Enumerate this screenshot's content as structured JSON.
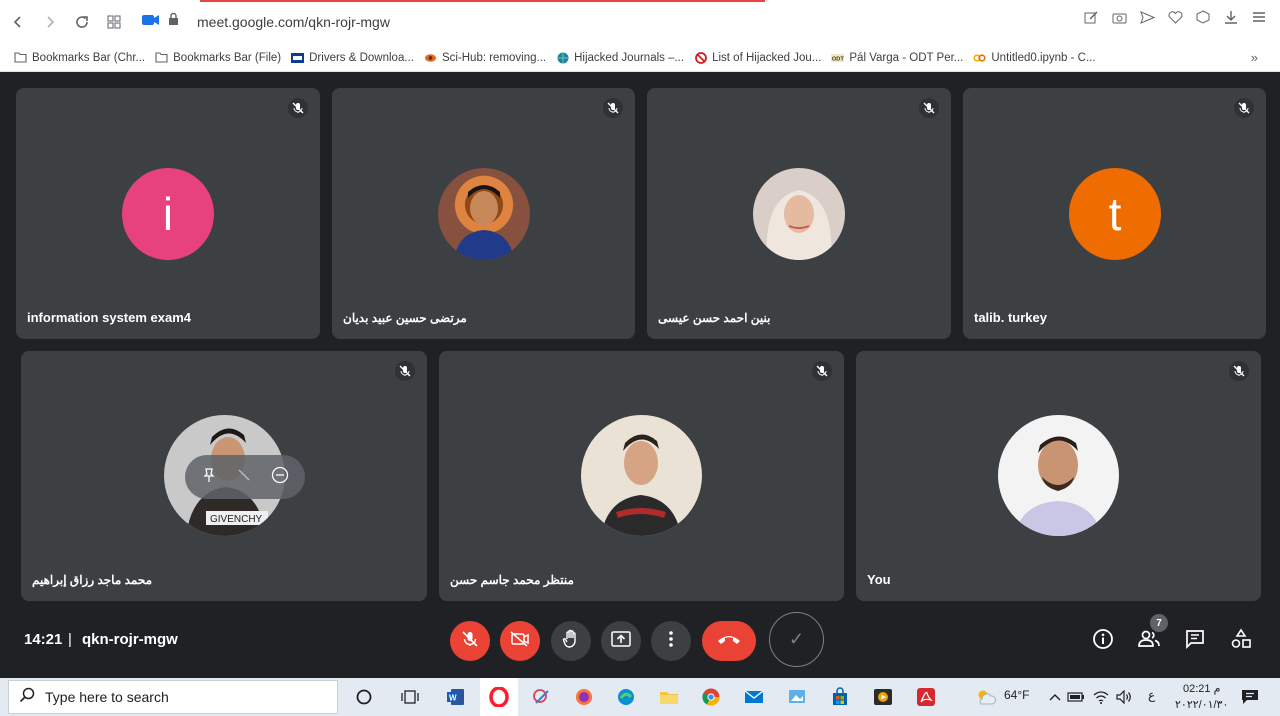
{
  "browser": {
    "url": "meet.google.com/qkn-rojr-mgw"
  },
  "bookmarks": [
    {
      "label": "Bookmarks Bar (Chr...",
      "icon": "folder-icon"
    },
    {
      "label": "Bookmarks Bar (File)",
      "icon": "folder-icon"
    },
    {
      "label": "Drivers & Downloa...",
      "icon": "hp-icon"
    },
    {
      "label": "Sci-Hub: removing...",
      "icon": "scihub-icon"
    },
    {
      "label": "Hijacked Journals –...",
      "icon": "globe-icon"
    },
    {
      "label": "List of Hijacked Jou...",
      "icon": "blocked-icon"
    },
    {
      "label": "Pál Varga - ODT Per...",
      "icon": "odt-icon"
    },
    {
      "label": "Untitled0.ipynb - C...",
      "icon": "colab-icon"
    }
  ],
  "participants_row1": [
    {
      "name": "information system exam4",
      "avatar_type": "letter",
      "letter": "i",
      "color": "#e8427c",
      "rtl": false
    },
    {
      "name": "مرتضى حسين عبيد بديان",
      "avatar_type": "photo",
      "rtl": true
    },
    {
      "name": "بنين احمد حسن عيسى",
      "avatar_type": "photo",
      "rtl": true
    },
    {
      "name": "talib. turkey",
      "avatar_type": "letter",
      "letter": "t",
      "color": "#ef6c00",
      "rtl": false
    }
  ],
  "participants_row2": [
    {
      "name": "محمد ماجد رزاق إبراهيم",
      "avatar_type": "photo",
      "rtl": true
    },
    {
      "name": "منتظر محمد جاسم حسن",
      "avatar_type": "photo",
      "rtl": true
    },
    {
      "name": "You",
      "avatar_type": "photo",
      "rtl": false
    }
  ],
  "tile_hover_text": "GIVENCHY",
  "controls": {
    "time": "14:21",
    "separator": "|",
    "meeting_code": "qkn-rojr-mgw",
    "participant_count": "7"
  },
  "taskbar": {
    "search_placeholder": "Type here to search",
    "temperature": "64°F",
    "lang": "ع",
    "time": "02:21 م",
    "date": "٢٠٢٢/٠١/٣٠"
  }
}
